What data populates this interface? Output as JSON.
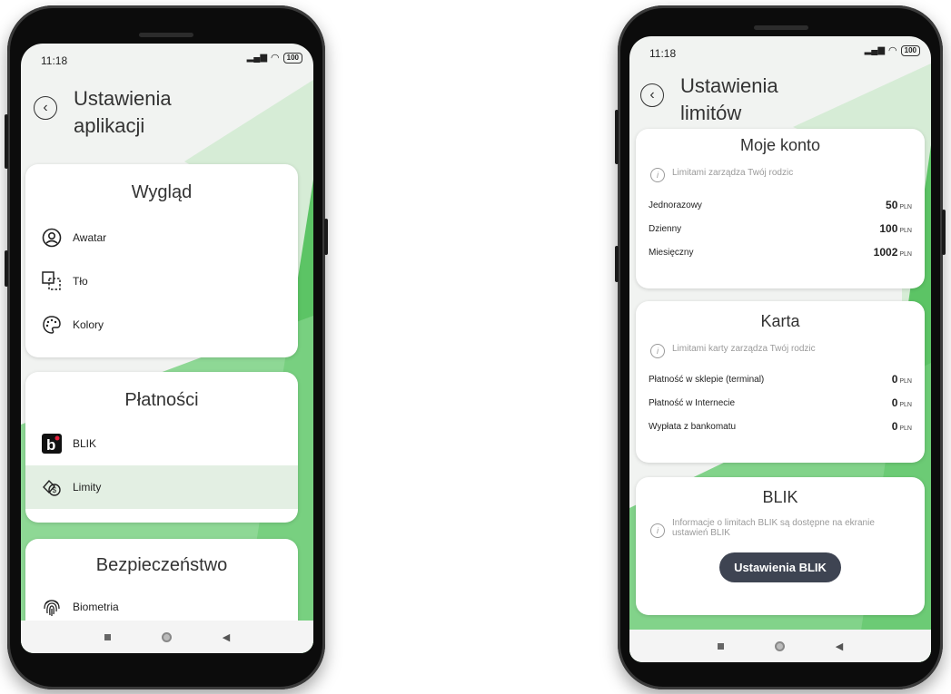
{
  "left_phone": {
    "status": {
      "time": "11:18",
      "battery": "100"
    },
    "title_line1": "Ustawienia",
    "title_line2": "aplikacji",
    "sections": {
      "appearance": {
        "title": "Wygląd",
        "items": [
          {
            "label": "Awatar",
            "icon": "avatar-icon"
          },
          {
            "label": "Tło",
            "icon": "background-icon"
          },
          {
            "label": "Kolory",
            "icon": "palette-icon"
          }
        ]
      },
      "payments": {
        "title": "Płatności",
        "items": [
          {
            "label": "BLIK",
            "icon": "blik-icon"
          },
          {
            "label": "Limity",
            "icon": "limits-icon",
            "selected": true
          }
        ]
      },
      "security": {
        "title": "Bezpieczeństwo",
        "items": [
          {
            "label": "Biometria",
            "icon": "fingerprint-icon"
          }
        ]
      }
    }
  },
  "right_phone": {
    "status": {
      "time": "11:18",
      "battery": "100"
    },
    "title_line1": "Ustawienia",
    "title_line2": "limitów",
    "account": {
      "title": "Moje konto",
      "info": "Limitami zarządza Twój rodzic",
      "rows": [
        {
          "label": "Jednorazowy",
          "amount": "50",
          "currency": "PLN"
        },
        {
          "label": "Dzienny",
          "amount": "100",
          "currency": "PLN"
        },
        {
          "label": "Miesięczny",
          "amount": "1002",
          "currency": "PLN"
        }
      ]
    },
    "card": {
      "title": "Karta",
      "info": "Limitami karty zarządza Twój rodzic",
      "rows": [
        {
          "label": "Płatność w sklepie (terminal)",
          "amount": "0",
          "currency": "PLN"
        },
        {
          "label": "Płatność w Internecie",
          "amount": "0",
          "currency": "PLN"
        },
        {
          "label": "Wypłata z bankomatu",
          "amount": "0",
          "currency": "PLN"
        }
      ]
    },
    "blik": {
      "title": "BLIK",
      "info": "Informacje o limitach BLIK są dostępne na ekranie ustawień BLIK",
      "button": "Ustawienia BLIK"
    }
  },
  "colors": {
    "accent_green": "#4cbf55",
    "light_green": "#cfe9cf",
    "button_dark": "#3e4452"
  }
}
